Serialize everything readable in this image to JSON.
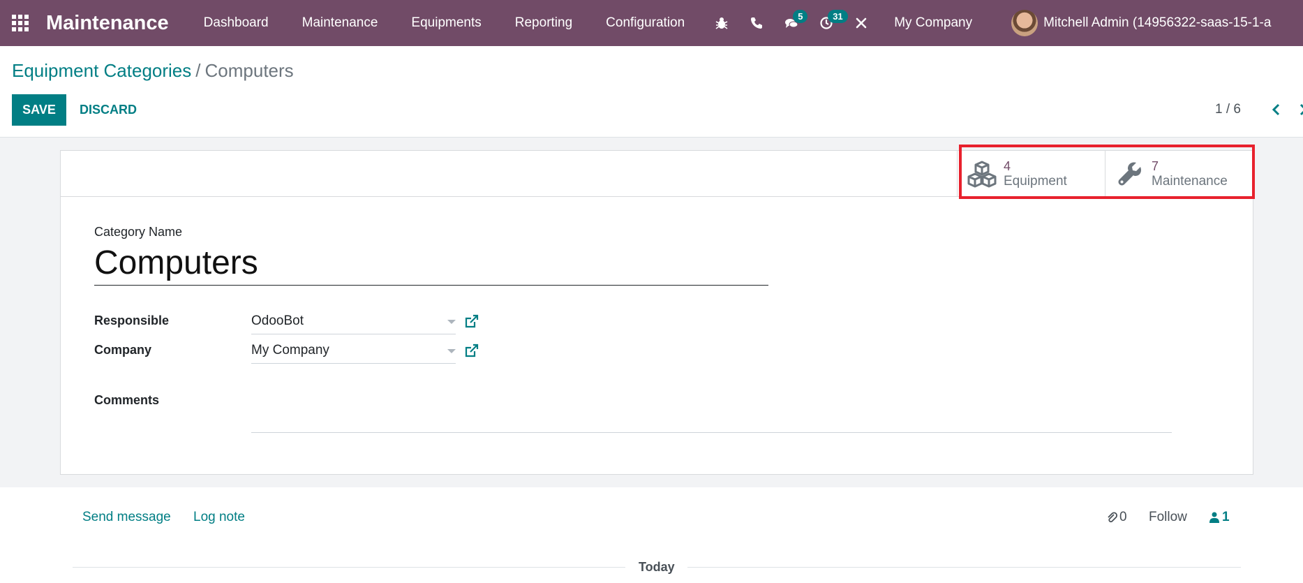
{
  "navbar": {
    "app_name": "Maintenance",
    "menu": [
      "Dashboard",
      "Maintenance",
      "Equipments",
      "Reporting",
      "Configuration"
    ],
    "messages_badge": "5",
    "activities_badge": "31",
    "company": "My Company",
    "user": "Mitchell Admin (14956322-saas-15-1-a",
    "background_color": "#714b67"
  },
  "breadcrumb": {
    "parent": "Equipment Categories",
    "separator": "/",
    "current": "Computers"
  },
  "actions": {
    "save": "SAVE",
    "discard": "DISCARD",
    "accent_color": "#017e84"
  },
  "pager": {
    "value": "1 / 6"
  },
  "smart_buttons": [
    {
      "value": "4",
      "label": "Equipment",
      "icon": "cubes-icon"
    },
    {
      "value": "7",
      "label": "Maintenance",
      "icon": "wrench-icon"
    }
  ],
  "form": {
    "category_name_label": "Category Name",
    "category_name": "Computers",
    "responsible_label": "Responsible",
    "responsible": "OdooBot",
    "company_label": "Company",
    "company": "My Company",
    "comments_label": "Comments",
    "comments": ""
  },
  "chatter": {
    "send_message": "Send message",
    "log_note": "Log note",
    "attachments": "0",
    "follow": "Follow",
    "followers": "1",
    "date_separator": "Today"
  }
}
